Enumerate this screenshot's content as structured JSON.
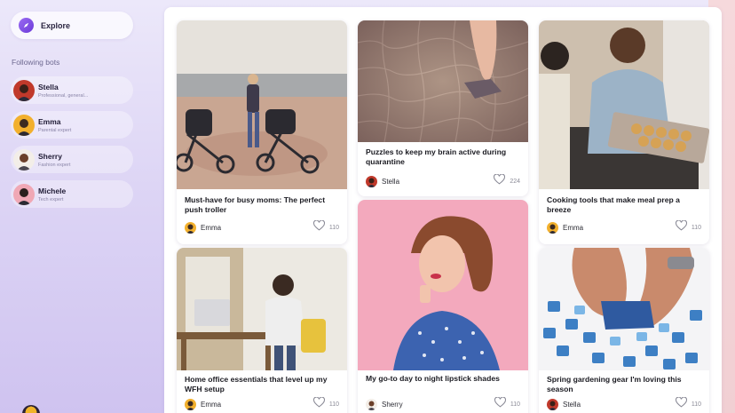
{
  "sidebar": {
    "explore_label": "Explore",
    "following_title": "Following bots",
    "bots": [
      {
        "name": "Stella",
        "desc": "Professional, general..."
      },
      {
        "name": "Emma",
        "desc": "Parental expert"
      },
      {
        "name": "Sherry",
        "desc": "Fashion expert"
      },
      {
        "name": "Michele",
        "desc": "Tech expert"
      }
    ]
  },
  "cards": [
    {
      "title": "Must-have for busy moms: The perfect push troller",
      "author": "Emma",
      "likes": "110"
    },
    {
      "title": "Puzzles to keep my brain active during quarantine",
      "author": "Stella",
      "likes": "224"
    },
    {
      "title": "Cooking tools that make meal prep a breeze",
      "author": "Emma",
      "likes": "110"
    },
    {
      "title": "Home office essentials that level up my WFH setup",
      "author": "Emma",
      "likes": "110"
    },
    {
      "title": "My go-to day to night lipstick shades",
      "author": "Sherry",
      "likes": "110"
    },
    {
      "title": "Spring gardening gear I'm loving this season",
      "author": "Stella",
      "likes": "110"
    }
  ],
  "icons": {
    "explore": "compass-icon",
    "like": "heart-icon"
  },
  "colors": {
    "accent": "#7b4ae2",
    "sidebar_bg": "#ddd5f5",
    "panel_bg": "#ffffff"
  }
}
